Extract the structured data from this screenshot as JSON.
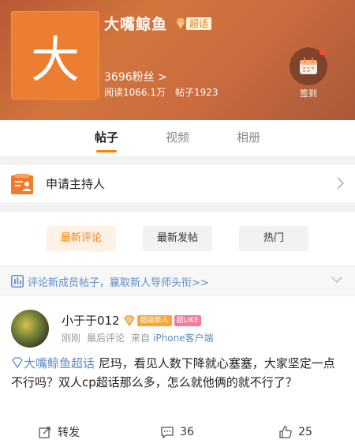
{
  "header": {
    "avatar_char": "大",
    "title": "大嘴鲸鱼",
    "super_topic_badge": "超话",
    "fans": "3696粉丝 >",
    "reads": "阅读1066.1万",
    "posts": "帖子1923",
    "checkin_label": "签到"
  },
  "tabs": [
    "帖子",
    "视频",
    "相册"
  ],
  "apply": {
    "label": "申请主持人"
  },
  "filters": [
    "最新评论",
    "最新发帖",
    "热门"
  ],
  "promo": {
    "text": "评论新成员帖子，赢取新人导师头衔>>"
  },
  "post": {
    "author": "小于于012",
    "badge_new": "超级新人",
    "badge_like": "超LIKE",
    "meta": {
      "time": "刚刚",
      "sort": "最后评论",
      "source_prefix": "来自",
      "client": "iPhone客户端"
    },
    "topic": "大嘴鲸鱼超话",
    "body": " 尼玛，看见人数下降就心塞塞，大家坚定一点不行吗？双人cp超话那么多，怎么就他俩的就不行了？",
    "actions": {
      "forward": "转发",
      "comments": "36",
      "likes": "25"
    }
  },
  "colors": {
    "accent": "#ff8200",
    "link": "#5d8cc7",
    "header_start": "#b85a33",
    "header_end": "#a95a3a"
  },
  "icons": [
    "diamond-icon",
    "calendar-icon",
    "chevron-right-icon",
    "chevron-down-icon",
    "forward-icon",
    "comment-icon",
    "like-icon",
    "host-application-icon",
    "promo-icon"
  ]
}
